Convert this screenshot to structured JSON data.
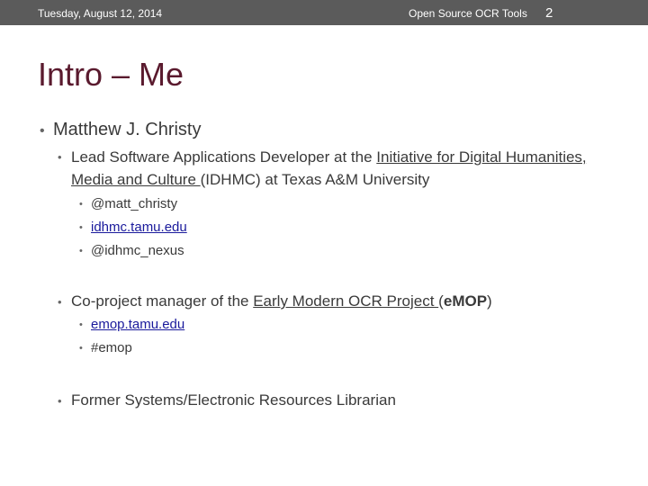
{
  "header": {
    "date": "Tuesday, August 12, 2014",
    "deck_title": "Open Source OCR Tools",
    "page_number": "2"
  },
  "slide": {
    "title": "Intro – Me",
    "name": "Matthew J. Christy",
    "role1": {
      "prefix": "Lead Software Applications Developer at the ",
      "org_link": "Initiative for Digital Humanities, Media and Culture ",
      "suffix": "(IDHMC) at Texas A&M University",
      "items": [
        "@matt_christy",
        "idhmc.tamu.edu",
        "@idhmc_nexus"
      ]
    },
    "role2": {
      "prefix": "Co-project manager of the ",
      "project_link": "Early Modern OCR Project ",
      "paren_open": "(",
      "bold_e": "e",
      "bold_mop": "MOP",
      "paren_close": ")",
      "items": [
        "emop.tamu.edu",
        "#emop"
      ]
    },
    "role3": "Former Systems/Electronic Resources Librarian"
  }
}
